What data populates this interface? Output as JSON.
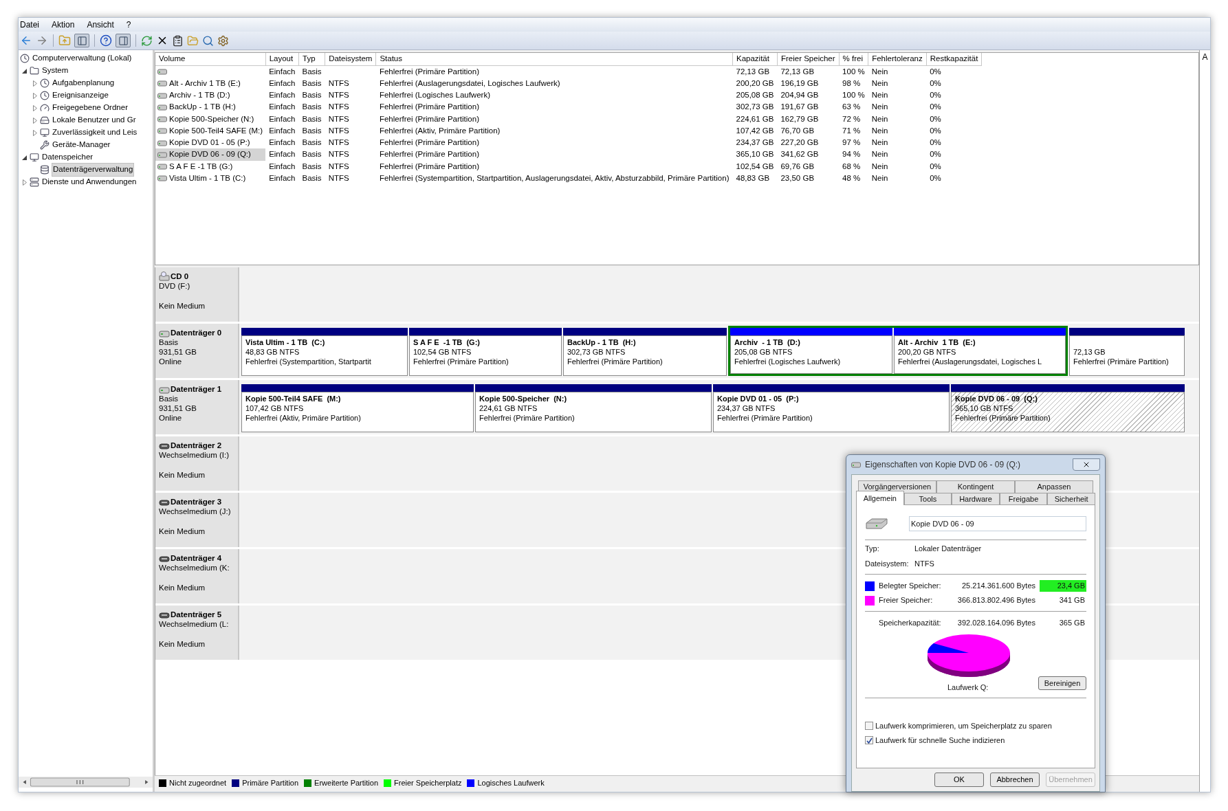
{
  "menu": [
    "Datei",
    "Aktion",
    "Ansicht",
    "?"
  ],
  "toolbar": {
    "tree_toggle_pressed": true,
    "action_toggle_pressed": true
  },
  "tree": [
    {
      "label": "Computerverwaltung (Lokal)",
      "selected": false,
      "children": [
        {
          "label": "System",
          "expanded": true,
          "selected": false,
          "children": [
            {
              "label": "Aufgabenplanung",
              "expanded": false,
              "selected": false
            },
            {
              "label": "Ereignisanzeige",
              "expanded": false,
              "selected": false
            },
            {
              "label": "Freigegebene Ordner",
              "expanded": false,
              "selected": false
            },
            {
              "label": "Lokale Benutzer und Gr",
              "expanded": false,
              "selected": false
            },
            {
              "label": "Zuverlässigkeit und Leis",
              "expanded": false,
              "selected": false
            },
            {
              "label": "Geräte-Manager",
              "selected": false
            }
          ]
        },
        {
          "label": "Datenspeicher",
          "expanded": true,
          "selected": false,
          "children": [
            {
              "label": "Datenträgerverwaltung",
              "selected": true
            }
          ]
        },
        {
          "label": "Dienste und Anwendungen",
          "expanded": false,
          "selected": false
        }
      ]
    }
  ],
  "table": {
    "columns": [
      "Volume",
      "Layout",
      "Typ",
      "Dateisystem",
      "Status",
      "Kapazität",
      "Freier Speicher",
      "% frei",
      "Fehlertoleranz",
      "Restkapazität"
    ],
    "rows": [
      {
        "selected": false,
        "layout": "Einfach",
        "type": "Basis",
        "status": "Fehlerfrei (Primäre Partition)",
        "capacity": "72,13 GB",
        "free": "72,13 GB",
        "pct": "100 %",
        "fault": "Nein",
        "rest": "0%"
      },
      {
        "selected": false,
        "volume": "Alt - Archiv 1 TB (E:)",
        "layout": "Einfach",
        "type": "Basis",
        "fs": "NTFS",
        "status": "Fehlerfrei (Auslagerungsdatei, Logisches Laufwerk)",
        "capacity": "200,20 GB",
        "free": "196,19 GB",
        "pct": "98 %",
        "fault": "Nein",
        "rest": "0%"
      },
      {
        "selected": false,
        "volume": "Archiv - 1 TB (D:)",
        "layout": "Einfach",
        "type": "Basis",
        "fs": "NTFS",
        "status": "Fehlerfrei (Logisches Laufwerk)",
        "capacity": "205,08 GB",
        "free": "204,94 GB",
        "pct": "100 %",
        "fault": "Nein",
        "rest": "0%"
      },
      {
        "selected": false,
        "volume": "BackUp - 1 TB (H:)",
        "layout": "Einfach",
        "type": "Basis",
        "fs": "NTFS",
        "status": "Fehlerfrei (Primäre Partition)",
        "capacity": "302,73 GB",
        "free": "191,67 GB",
        "pct": "63 %",
        "fault": "Nein",
        "rest": "0%"
      },
      {
        "selected": false,
        "volume": "Kopie 500-Speicher (N:)",
        "layout": "Einfach",
        "type": "Basis",
        "fs": "NTFS",
        "status": "Fehlerfrei (Primäre Partition)",
        "capacity": "224,61 GB",
        "free": "162,79 GB",
        "pct": "72 %",
        "fault": "Nein",
        "rest": "0%"
      },
      {
        "selected": false,
        "volume": "Kopie 500-Teil4 SAFE (M:)",
        "layout": "Einfach",
        "type": "Basis",
        "fs": "NTFS",
        "status": "Fehlerfrei (Aktiv, Primäre Partition)",
        "capacity": "107,42 GB",
        "free": "76,70 GB",
        "pct": "71 %",
        "fault": "Nein",
        "rest": "0%"
      },
      {
        "selected": false,
        "volume": "Kopie DVD 01 - 05 (P:)",
        "layout": "Einfach",
        "type": "Basis",
        "fs": "NTFS",
        "status": "Fehlerfrei (Primäre Partition)",
        "capacity": "234,37 GB",
        "free": "227,20 GB",
        "pct": "97 %",
        "fault": "Nein",
        "rest": "0%"
      },
      {
        "selected": true,
        "volume": "Kopie DVD 06 - 09 (Q:)",
        "layout": "Einfach",
        "type": "Basis",
        "fs": "NTFS",
        "status": "Fehlerfrei (Primäre Partition)",
        "capacity": "365,10 GB",
        "free": "341,62 GB",
        "pct": "94 %",
        "fault": "Nein",
        "rest": "0%"
      },
      {
        "selected": false,
        "volume": "S A F E -1 TB (G:)",
        "layout": "Einfach",
        "type": "Basis",
        "fs": "NTFS",
        "status": "Fehlerfrei (Primäre Partition)",
        "capacity": "102,54 GB",
        "free": "69,76 GB",
        "pct": "68 %",
        "fault": "Nein",
        "rest": "0%"
      },
      {
        "selected": false,
        "volume": "Vista Ultim - 1 TB (C:)",
        "layout": "Einfach",
        "type": "Basis",
        "fs": "NTFS",
        "status": "Fehlerfrei (Systempartition, Startpartition, Auslagerungsdatei, Aktiv, Absturzabbild, Primäre Partition)",
        "capacity": "48,83 GB",
        "free": "23,50 GB",
        "pct": "48 %",
        "fault": "Nein",
        "rest": "0%"
      }
    ]
  },
  "disks": [
    {
      "kind": "cd",
      "name": "CD 0",
      "type": "DVD (F:)",
      "status": "Kein Medium"
    },
    {
      "kind": "disk",
      "name": "Datenträger 0",
      "type": "Basis",
      "size": "931,51 GB",
      "status": "Online",
      "partitions": [
        {
          "kind": "primary",
          "selected": false,
          "title": "Vista Ultim - 1 TB  (C:)",
          "size": "48,83 GB NTFS",
          "status": "Fehlerfrei (Systempartition, Startpartit"
        },
        {
          "kind": "primary",
          "selected": false,
          "title": "S A F E  -1 TB  (G:)",
          "size": "102,54 GB NTFS",
          "status": "Fehlerfrei (Primäre Partition)"
        },
        {
          "kind": "primary",
          "selected": false,
          "title": "BackUp - 1 TB  (H:)",
          "size": "302,73 GB NTFS",
          "status": "Fehlerfrei (Primäre Partition)"
        },
        {
          "kind": "extended",
          "children": [
            {
              "kind": "logical",
              "selected": false,
              "title": "Archiv  - 1 TB  (D:)",
              "size": "205,08 GB NTFS",
              "status": "Fehlerfrei (Logisches Laufwerk)"
            },
            {
              "kind": "logical",
              "selected": false,
              "title": "Alt - Archiv  1 TB  (E:)",
              "size": "200,20 GB NTFS",
              "status": "Fehlerfrei (Auslagerungsdatei, Logisches L"
            }
          ]
        },
        {
          "kind": "primary",
          "selected": false,
          "size": "72,13 GB",
          "status": "Fehlerfrei (Primäre Partition)"
        }
      ]
    },
    {
      "kind": "disk",
      "name": "Datenträger 1",
      "type": "Basis",
      "size": "931,51 GB",
      "status": "Online",
      "partitions": [
        {
          "kind": "primary",
          "selected": false,
          "title": "Kopie 500-Teil4 SAFE  (M:)",
          "size": "107,42 GB NTFS",
          "status": "Fehlerfrei (Aktiv, Primäre Partition)"
        },
        {
          "kind": "primary",
          "selected": false,
          "title": "Kopie 500-Speicher  (N:)",
          "size": "224,61 GB NTFS",
          "status": "Fehlerfrei (Primäre Partition)"
        },
        {
          "kind": "primary",
          "selected": false,
          "title": "Kopie DVD 01 - 05  (P:)",
          "size": "234,37 GB NTFS",
          "status": "Fehlerfrei (Primäre Partition)"
        },
        {
          "kind": "primary",
          "selected": true,
          "title": "Kopie DVD 06 - 09  (Q:)",
          "size": "365,10 GB NTFS",
          "status": "Fehlerfrei (Primäre Partition)"
        }
      ]
    },
    {
      "kind": "removable",
      "name": "Datenträger 2",
      "type": "Wechselmedium (I:)",
      "status": "Kein Medium"
    },
    {
      "kind": "removable",
      "name": "Datenträger 3",
      "type": "Wechselmedium (J:)",
      "status": "Kein Medium"
    },
    {
      "kind": "removable",
      "name": "Datenträger 4",
      "type": "Wechselmedium (K:",
      "status": "Kein Medium"
    },
    {
      "kind": "removable",
      "name": "Datenträger 5",
      "type": "Wechselmedium (L:",
      "status": "Kein Medium"
    }
  ],
  "legend": [
    {
      "label": "Nicht zugeordnet",
      "color": "#000000"
    },
    {
      "label": "Primäre Partition",
      "color": "#000080"
    },
    {
      "label": "Erweiterte Partition",
      "color": "#008000"
    },
    {
      "label": "Freier Speicherplatz",
      "color": "#00ff00"
    },
    {
      "label": "Logisches Laufwerk",
      "color": "#0000ff"
    }
  ],
  "actions_pane": {
    "title": "A"
  },
  "dialog": {
    "title": "Eigenschaften von Kopie DVD 06 - 09 (Q:)",
    "tab_rows": [
      [
        {
          "label": "Vorgängerversionen",
          "selected": false
        },
        {
          "label": "Kontingent",
          "selected": false
        },
        {
          "label": "Anpassen",
          "selected": false
        }
      ],
      [
        {
          "label": "Allgemein",
          "selected": true
        },
        {
          "label": "Tools",
          "selected": false
        },
        {
          "label": "Hardware",
          "selected": false
        },
        {
          "label": "Freigabe",
          "selected": false
        },
        {
          "label": "Sicherheit",
          "selected": false
        }
      ]
    ],
    "name_value": "Kopie DVD 06 - 09",
    "info": [
      {
        "label": "Typ:",
        "value": "Lokaler Datenträger"
      },
      {
        "label": "Dateisystem:",
        "value": "NTFS"
      }
    ],
    "usage": [
      {
        "label": "Belegter Speicher:",
        "bytes": "25.214.361.600 Bytes",
        "gb": "23,4 GB",
        "color": "#0000ff",
        "highlighted": true
      },
      {
        "label": "Freier Speicher:",
        "bytes": "366.813.802.496 Bytes",
        "gb": "341 GB",
        "color": "#ff00ff",
        "highlighted": false
      }
    ],
    "capacity": {
      "label": "Speicherkapazität:",
      "bytes": "392.028.164.096 Bytes",
      "gb": "365 GB"
    },
    "drive_label": "Laufwerk Q:",
    "cleanup_button": "Bereinigen",
    "options": [
      {
        "label": "Laufwerk komprimieren, um Speicherplatz zu sparen",
        "checked": false
      },
      {
        "label": "Laufwerk für schnelle Suche indizieren",
        "checked": true
      }
    ],
    "buttons": [
      {
        "label": "OK",
        "disabled": false
      },
      {
        "label": "Abbrechen",
        "disabled": false
      },
      {
        "label": "Übernehmen",
        "disabled": true
      }
    ]
  }
}
